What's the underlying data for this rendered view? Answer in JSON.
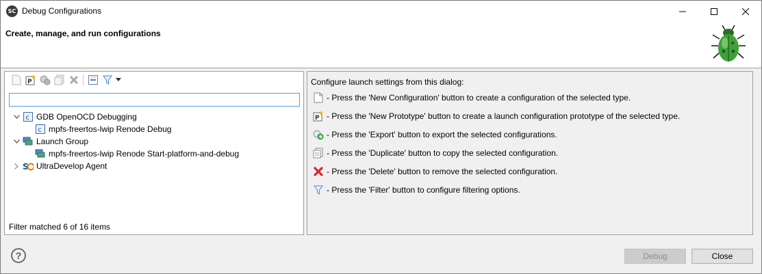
{
  "window": {
    "app_icon_text": "SC",
    "title": "Debug Configurations"
  },
  "header": {
    "title": "Create, manage, and run configurations"
  },
  "left": {
    "filter_value": "",
    "tree": [
      {
        "label": "GDB OpenOCD Debugging",
        "expanded": true,
        "icon": "gdb-c-icon"
      },
      {
        "label": "mpfs-freertos-lwip Renode Debug",
        "icon": "c-config-icon"
      },
      {
        "label": "Launch Group",
        "expanded": true,
        "icon": "launch-group-icon"
      },
      {
        "label": "mpfs-freertos-lwip Renode Start-platform-and-debug",
        "icon": "launch-config-icon"
      },
      {
        "label": "UltraDevelop Agent",
        "expanded": false,
        "icon": "sc-agent-icon"
      }
    ],
    "status": "Filter matched 6 of 16 items"
  },
  "right": {
    "intro": "Configure launch settings from this dialog:",
    "items": [
      {
        "text": "- Press the 'New Configuration' button to create a configuration of the selected type.",
        "icon": "new-config-icon"
      },
      {
        "text": "- Press the 'New Prototype' button to create a launch configuration prototype of the selected type.",
        "icon": "new-prototype-icon"
      },
      {
        "text": "- Press the 'Export' button to export the selected configurations.",
        "icon": "export-icon"
      },
      {
        "text": "- Press the 'Duplicate' button to copy the selected configuration.",
        "icon": "duplicate-icon"
      },
      {
        "text": "- Press the 'Delete' button to remove the selected configuration.",
        "icon": "delete-icon"
      },
      {
        "text": "- Press the 'Filter' button to configure filtering options.",
        "icon": "filter-icon"
      }
    ]
  },
  "buttons": {
    "help_label": "?",
    "debug_label": "Debug",
    "close_label": "Close"
  },
  "colors": {
    "accent": "#569de5",
    "delete_red": "#d9262b",
    "bug_green": "#3fa03a"
  }
}
